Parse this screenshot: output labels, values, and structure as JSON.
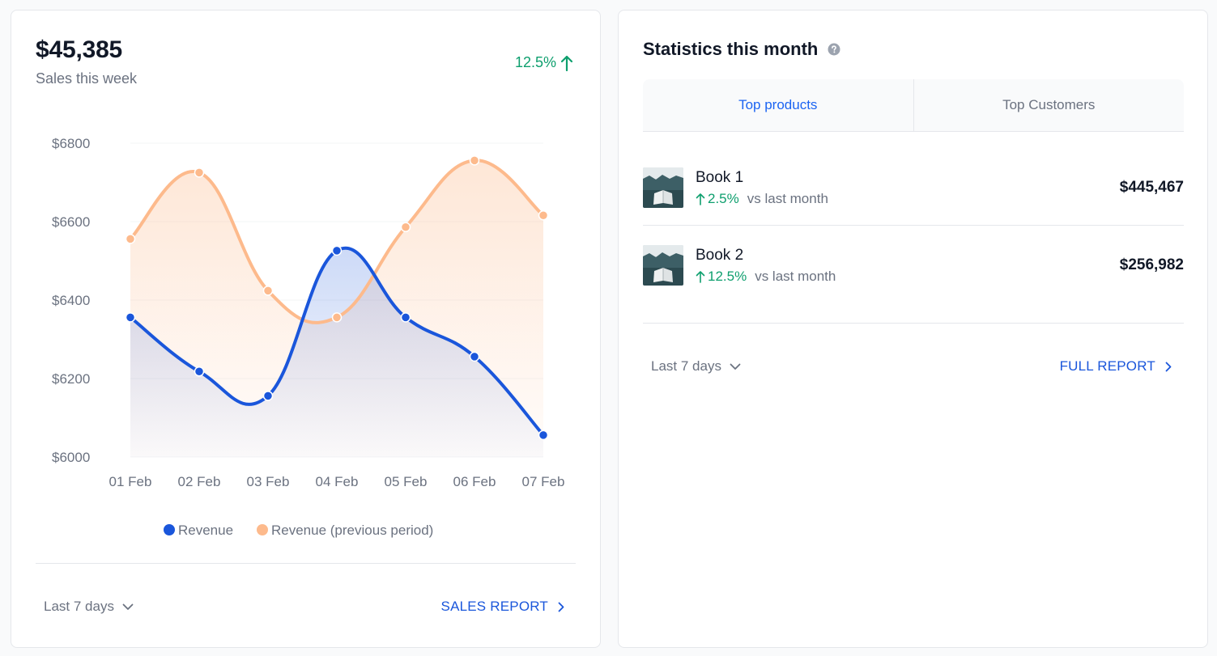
{
  "sales": {
    "amount": "$45,385",
    "subtitle": "Sales this week",
    "change": "12.5%",
    "range_label": "Last 7 days",
    "report_label": "SALES REPORT"
  },
  "chart_data": {
    "type": "area",
    "categories": [
      "01 Feb",
      "02 Feb",
      "03 Feb",
      "04 Feb",
      "05 Feb",
      "06 Feb",
      "07 Feb"
    ],
    "y_ticks": [
      "$6800",
      "$6600",
      "$6400",
      "$6200",
      "$6000"
    ],
    "ylim": [
      6000,
      6800
    ],
    "series": [
      {
        "name": "Revenue",
        "color": "#1a56db",
        "values": [
          6356,
          6218,
          6156,
          6526,
          6356,
          6256,
          6056
        ]
      },
      {
        "name": "Revenue (previous period)",
        "color": "#fdba8c",
        "values": [
          6556,
          6725,
          6424,
          6356,
          6586,
          6756,
          6616
        ]
      }
    ],
    "legend_position": "bottom-center",
    "grid": true
  },
  "stats": {
    "title": "Statistics this month",
    "help_icon": "question-circle-icon",
    "tabs": [
      {
        "label": "Top products",
        "active": true
      },
      {
        "label": "Top Customers",
        "active": false
      }
    ],
    "products": [
      {
        "name": "Book 1",
        "change": "2.5%",
        "vs": "vs last month",
        "value": "$445,467"
      },
      {
        "name": "Book 2",
        "change": "12.5%",
        "vs": "vs last month",
        "value": "$256,982"
      }
    ],
    "range_label": "Last 7 days",
    "report_label": "FULL REPORT"
  },
  "colors": {
    "accent_blue": "#1a56db",
    "positive_green": "#0e9f6e",
    "series_orange": "#fdba8c"
  }
}
